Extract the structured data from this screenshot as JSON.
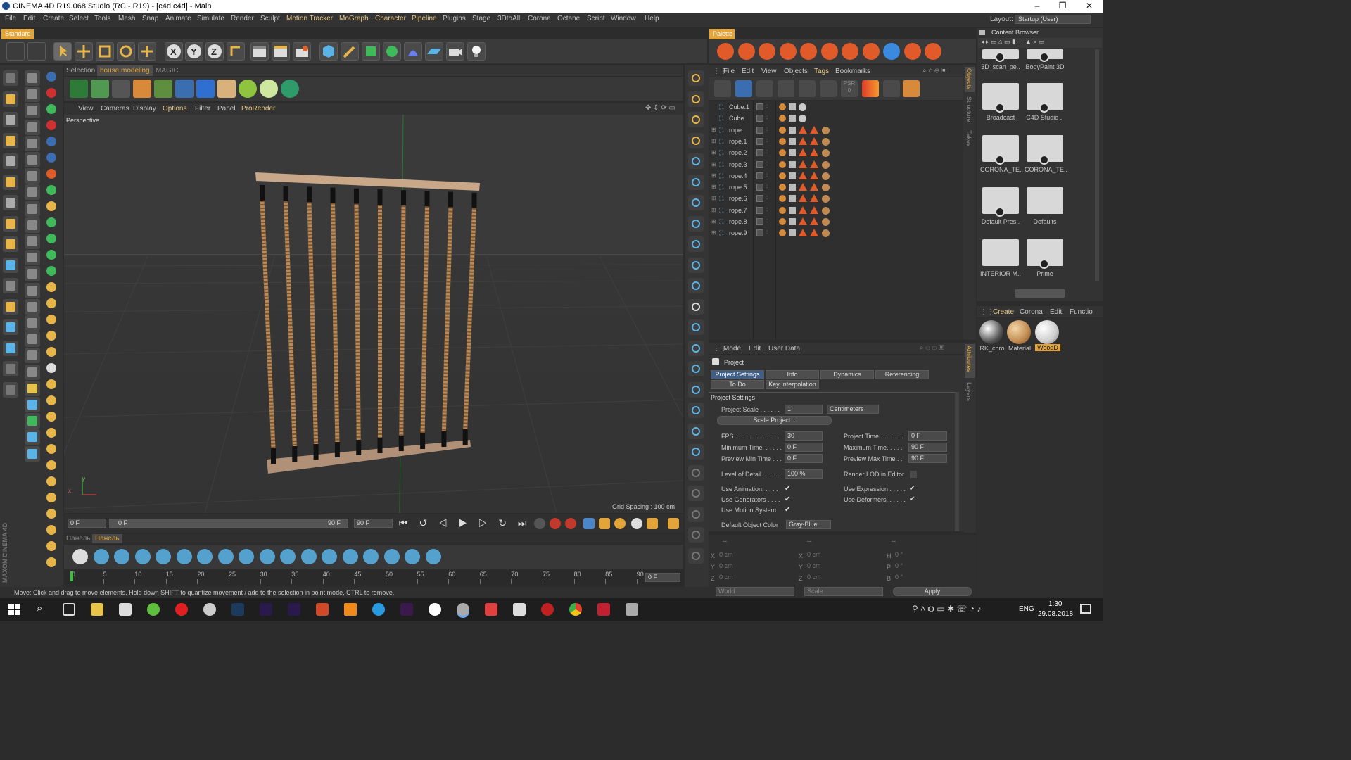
{
  "window": {
    "title": "CINEMA 4D R19.068 Studio (RC - R19) - [c4d.c4d] - Main",
    "minimize": "–",
    "maximize": "❐",
    "close": "✕"
  },
  "menubar": {
    "items": [
      "File",
      "Edit",
      "Create",
      "Select",
      "Tools",
      "Mesh",
      "Snap",
      "Animate",
      "Simulate",
      "Render",
      "Sculpt",
      "Motion Tracker",
      "MoGraph",
      "Character",
      "Pipeline",
      "Plugins",
      "Stage",
      "3DtoAll",
      "Corona",
      "Octane",
      "Script",
      "Window",
      "Help"
    ],
    "layout_label": "Layout:",
    "layout_value": "Startup (User)"
  },
  "left_panel": {
    "header": "Standard",
    "tabs": [
      "Selection",
      "house modeling",
      "MAGIC"
    ]
  },
  "viewport": {
    "menu": [
      "View",
      "Cameras",
      "Display",
      "Options",
      "Filter",
      "Panel",
      "ProRender"
    ],
    "camera": "Perspective",
    "grid_spacing": "Grid Spacing : 100 cm",
    "axis_y": "y",
    "axis_x": "x"
  },
  "timeline": {
    "start": "0 F",
    "slider_left": "0 F",
    "slider_right": "90 F",
    "end": "90 F",
    "ruler_ticks": [
      "0",
      "5",
      "10",
      "15",
      "20",
      "25",
      "30",
      "35",
      "40",
      "45",
      "50",
      "55",
      "60",
      "65",
      "70",
      "75",
      "80",
      "85",
      "90"
    ],
    "current": "0 F"
  },
  "bottom_tabs": [
    "Панель",
    "Панель"
  ],
  "status": "Move: Click and drag to move elements. Hold down SHIFT to quantize movement / add to the selection in point mode, CTRL to remove.",
  "maxon_logo": "MAXON CINEMA 4D",
  "palette": {
    "header": "Palette"
  },
  "object_manager": {
    "menu": [
      "File",
      "Edit",
      "View",
      "Objects",
      "Tags",
      "Bookmarks"
    ],
    "psr": "PSR",
    "psr_value": "0",
    "objects": [
      "Cube.1",
      "Cube",
      "rope",
      "rope.1",
      "rope.2",
      "rope.3",
      "rope.4",
      "rope.5",
      "rope.6",
      "rope.7",
      "rope.8",
      "rope.9"
    ],
    "side_tabs": [
      "Objects",
      "Structure",
      "Takes"
    ]
  },
  "attributes": {
    "menu": [
      "Mode",
      "Edit",
      "User Data"
    ],
    "title": "Project",
    "tabs": [
      "Project Settings",
      "Info",
      "Dynamics",
      "Referencing",
      "To Do",
      "Key Interpolation"
    ],
    "section": "Project Settings",
    "project_scale_label": "Project Scale . . . . . .",
    "project_scale": "1",
    "units": "Centimeters",
    "scale_project_btn": "Scale Project...",
    "fps_label": "FPS . . . . . . . . . . . . .",
    "fps": "30",
    "project_time_label": "Project Time . . . . . . .",
    "project_time": "0 F",
    "min_time_label": "Minimum Time. . . . . .",
    "min_time": "0 F",
    "max_time_label": "Maximum Time. . . . .",
    "max_time": "90 F",
    "prev_min_label": "Preview Min Time . . .",
    "prev_min": "0 F",
    "prev_max_label": "Preview Max Time . .",
    "prev_max": "90 F",
    "lod_label": "Level of Detail . . . . . .",
    "lod": "100 %",
    "render_lod_label": "Render LOD in Editor",
    "use_anim_label": "Use Animation. . . . .",
    "use_expr_label": "Use Expression . . . . .",
    "use_gen_label": "Use Generators . . . .",
    "use_def_label": "Use Deformers. . . . . .",
    "use_motion_label": "Use Motion System",
    "default_color_label": "Default Object Color",
    "default_color": "Gray-Blue",
    "side_tabs": [
      "Attributes",
      "Layers"
    ]
  },
  "coordinates": {
    "header": [
      "--",
      "--",
      "--"
    ],
    "rows": [
      [
        "X",
        "0 cm",
        "X",
        "0 cm",
        "H",
        "0 °"
      ],
      [
        "Y",
        "0 cm",
        "Y",
        "0 cm",
        "P",
        "0 °"
      ],
      [
        "Z",
        "0 cm",
        "Z",
        "0 cm",
        "B",
        "0 °"
      ]
    ],
    "mode": "World",
    "scale": "Scale",
    "apply": "Apply"
  },
  "content_browser": {
    "title": "Content Browser",
    "items": [
      "3D_scan_pe..",
      "BodyPaint 3D",
      "Broadcast",
      "C4D Studio ..",
      "CORONA_TE..",
      "CORONA_TE..",
      "Default Pres..",
      "Defaults",
      "INTERIOR M..",
      "Prime"
    ]
  },
  "material_manager": {
    "menu": [
      "Create",
      "Corona",
      "Edit",
      "Functio"
    ],
    "materials": [
      "RK_chro",
      "Material",
      "WoodD"
    ]
  },
  "taskbar": {
    "lang": "ENG",
    "time": "1:30",
    "date": "29.08.2018"
  },
  "colors": {
    "accent": "#e3a53a",
    "selected_tab": "#3e5f8a",
    "viewport_bg": "#3a3a3a"
  }
}
